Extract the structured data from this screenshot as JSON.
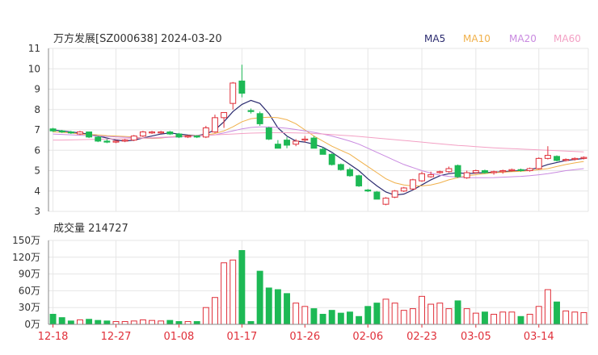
{
  "header": {
    "title": "万方发展[SZ000638] 2024-03-20",
    "ma_legend": [
      {
        "label": "MA5",
        "color": "#2b2b6f"
      },
      {
        "label": "MA10",
        "color": "#f0b04a"
      },
      {
        "label": "MA20",
        "color": "#c98ae0"
      },
      {
        "label": "MA60",
        "color": "#f3a0c4"
      }
    ]
  },
  "volume_panel": {
    "title": "成交量 214727",
    "y_ticks": [
      "150万",
      "120万",
      "90万",
      "60万",
      "30万",
      "0万"
    ]
  },
  "colors": {
    "up": "#e0303a",
    "down": "#1db955",
    "grid": "#e6e6e6",
    "axis": "#888888"
  },
  "chart_data": {
    "type": "candlestick",
    "ylim": [
      3,
      11
    ],
    "y_ticks": [
      "11",
      "10",
      "9",
      "8",
      "7",
      "6",
      "5",
      "4",
      "3"
    ],
    "x_tick_labels": [
      {
        "label": "12-18",
        "index": 0
      },
      {
        "label": "12-27",
        "index": 7
      },
      {
        "label": "01-08",
        "index": 14
      },
      {
        "label": "01-17",
        "index": 21
      },
      {
        "label": "01-26",
        "index": 28
      },
      {
        "label": "02-06",
        "index": 35
      },
      {
        "label": "02-23",
        "index": 41
      },
      {
        "label": "03-05",
        "index": 47
      },
      {
        "label": "03-14",
        "index": 54
      }
    ],
    "volume_unit": "万",
    "volume_ylim": [
      0,
      150
    ],
    "candles": [
      {
        "o": 7.05,
        "h": 7.1,
        "l": 6.9,
        "c": 6.95,
        "v": 18
      },
      {
        "o": 6.95,
        "h": 7.0,
        "l": 6.85,
        "c": 6.9,
        "v": 12
      },
      {
        "o": 6.9,
        "h": 6.95,
        "l": 6.8,
        "c": 6.85,
        "v": 6
      },
      {
        "o": 6.8,
        "h": 6.95,
        "l": 6.75,
        "c": 6.9,
        "v": 8
      },
      {
        "o": 6.9,
        "h": 6.92,
        "l": 6.6,
        "c": 6.65,
        "v": 9
      },
      {
        "o": 6.65,
        "h": 6.7,
        "l": 6.4,
        "c": 6.45,
        "v": 7
      },
      {
        "o": 6.45,
        "h": 6.55,
        "l": 6.35,
        "c": 6.4,
        "v": 6
      },
      {
        "o": 6.4,
        "h": 6.5,
        "l": 6.35,
        "c": 6.45,
        "v": 5
      },
      {
        "o": 6.45,
        "h": 6.55,
        "l": 6.4,
        "c": 6.5,
        "v": 5
      },
      {
        "o": 6.5,
        "h": 6.75,
        "l": 6.45,
        "c": 6.7,
        "v": 6
      },
      {
        "o": 6.7,
        "h": 6.95,
        "l": 6.65,
        "c": 6.9,
        "v": 8
      },
      {
        "o": 6.85,
        "h": 6.95,
        "l": 6.8,
        "c": 6.9,
        "v": 7
      },
      {
        "o": 6.85,
        "h": 6.95,
        "l": 6.8,
        "c": 6.9,
        "v": 6
      },
      {
        "o": 6.9,
        "h": 6.95,
        "l": 6.75,
        "c": 6.8,
        "v": 7
      },
      {
        "o": 6.8,
        "h": 6.85,
        "l": 6.6,
        "c": 6.65,
        "v": 5
      },
      {
        "o": 6.65,
        "h": 6.75,
        "l": 6.6,
        "c": 6.7,
        "v": 5
      },
      {
        "o": 6.7,
        "h": 6.75,
        "l": 6.6,
        "c": 6.65,
        "v": 5
      },
      {
        "o": 6.65,
        "h": 7.2,
        "l": 6.6,
        "c": 7.1,
        "v": 30
      },
      {
        "o": 6.9,
        "h": 7.75,
        "l": 6.85,
        "c": 7.6,
        "v": 48
      },
      {
        "o": 7.6,
        "h": 7.85,
        "l": 7.1,
        "c": 7.85,
        "v": 110
      },
      {
        "o": 8.3,
        "h": 9.35,
        "l": 8.0,
        "c": 9.3,
        "v": 115
      },
      {
        "o": 9.4,
        "h": 10.2,
        "l": 8.6,
        "c": 8.8,
        "v": 132
      },
      {
        "o": 7.95,
        "h": 8.05,
        "l": 7.8,
        "c": 7.9,
        "v": 5
      },
      {
        "o": 7.8,
        "h": 7.9,
        "l": 7.2,
        "c": 7.3,
        "v": 95
      },
      {
        "o": 7.1,
        "h": 7.15,
        "l": 6.5,
        "c": 6.55,
        "v": 65
      },
      {
        "o": 6.3,
        "h": 6.5,
        "l": 6.1,
        "c": 6.1,
        "v": 62
      },
      {
        "o": 6.5,
        "h": 6.65,
        "l": 6.1,
        "c": 6.25,
        "v": 55
      },
      {
        "o": 6.3,
        "h": 6.55,
        "l": 6.2,
        "c": 6.45,
        "v": 38
      },
      {
        "o": 6.5,
        "h": 6.7,
        "l": 6.4,
        "c": 6.55,
        "v": 32
      },
      {
        "o": 6.6,
        "h": 6.7,
        "l": 6.2,
        "c": 6.1,
        "v": 28
      },
      {
        "o": 6.05,
        "h": 6.15,
        "l": 5.8,
        "c": 5.8,
        "v": 18
      },
      {
        "o": 5.8,
        "h": 5.85,
        "l": 5.25,
        "c": 5.3,
        "v": 25
      },
      {
        "o": 5.3,
        "h": 5.35,
        "l": 5.0,
        "c": 5.05,
        "v": 20
      },
      {
        "o": 5.05,
        "h": 5.15,
        "l": 4.7,
        "c": 4.75,
        "v": 22
      },
      {
        "o": 4.75,
        "h": 4.8,
        "l": 4.2,
        "c": 4.25,
        "v": 14
      },
      {
        "o": 4.05,
        "h": 4.1,
        "l": 3.95,
        "c": 4.0,
        "v": 32
      },
      {
        "o": 3.95,
        "h": 4.0,
        "l": 3.6,
        "c": 3.6,
        "v": 38
      },
      {
        "o": 3.35,
        "h": 3.7,
        "l": 3.3,
        "c": 3.65,
        "v": 45
      },
      {
        "o": 3.7,
        "h": 4.05,
        "l": 3.65,
        "c": 4.0,
        "v": 38
      },
      {
        "o": 4.0,
        "h": 4.2,
        "l": 3.95,
        "c": 4.15,
        "v": 25
      },
      {
        "o": 4.1,
        "h": 4.6,
        "l": 4.05,
        "c": 4.55,
        "v": 28
      },
      {
        "o": 4.5,
        "h": 4.95,
        "l": 4.45,
        "c": 4.85,
        "v": 50
      },
      {
        "o": 4.7,
        "h": 4.95,
        "l": 4.65,
        "c": 4.8,
        "v": 36
      },
      {
        "o": 4.9,
        "h": 5.0,
        "l": 4.85,
        "c": 4.95,
        "v": 38
      },
      {
        "o": 4.95,
        "h": 5.2,
        "l": 4.9,
        "c": 5.1,
        "v": 28
      },
      {
        "o": 5.25,
        "h": 5.3,
        "l": 4.65,
        "c": 4.7,
        "v": 42
      },
      {
        "o": 4.65,
        "h": 5.0,
        "l": 4.6,
        "c": 4.9,
        "v": 28
      },
      {
        "o": 4.9,
        "h": 5.05,
        "l": 4.85,
        "c": 5.0,
        "v": 20
      },
      {
        "o": 5.0,
        "h": 5.05,
        "l": 4.85,
        "c": 4.9,
        "v": 22
      },
      {
        "o": 4.9,
        "h": 5.0,
        "l": 4.8,
        "c": 4.95,
        "v": 18
      },
      {
        "o": 4.95,
        "h": 5.05,
        "l": 4.85,
        "c": 5.0,
        "v": 22
      },
      {
        "o": 5.0,
        "h": 5.1,
        "l": 4.95,
        "c": 5.05,
        "v": 22
      },
      {
        "o": 5.05,
        "h": 5.1,
        "l": 4.95,
        "c": 5.0,
        "v": 14
      },
      {
        "o": 5.0,
        "h": 5.15,
        "l": 4.95,
        "c": 5.1,
        "v": 18
      },
      {
        "o": 5.1,
        "h": 5.65,
        "l": 5.05,
        "c": 5.6,
        "v": 32
      },
      {
        "o": 5.6,
        "h": 6.2,
        "l": 5.55,
        "c": 5.75,
        "v": 62
      },
      {
        "o": 5.7,
        "h": 5.75,
        "l": 5.45,
        "c": 5.5,
        "v": 40
      },
      {
        "o": 5.5,
        "h": 5.6,
        "l": 5.45,
        "c": 5.55,
        "v": 24
      },
      {
        "o": 5.55,
        "h": 5.65,
        "l": 5.5,
        "c": 5.6,
        "v": 22
      },
      {
        "o": 5.6,
        "h": 5.7,
        "l": 5.55,
        "c": 5.65,
        "v": 21
      }
    ],
    "ma": {
      "MA5": [
        7.0,
        6.95,
        6.9,
        6.85,
        6.8,
        6.7,
        6.6,
        6.5,
        6.45,
        6.5,
        6.6,
        6.7,
        6.8,
        6.85,
        6.8,
        6.75,
        6.72,
        6.8,
        7.0,
        7.4,
        7.9,
        8.25,
        8.45,
        8.3,
        7.8,
        7.1,
        6.7,
        6.45,
        6.4,
        6.3,
        6.15,
        5.9,
        5.6,
        5.3,
        5.0,
        4.6,
        4.25,
        3.95,
        3.8,
        3.85,
        4.05,
        4.3,
        4.55,
        4.75,
        4.85,
        4.9,
        4.85,
        4.88,
        4.9,
        4.92,
        4.95,
        4.98,
        5.0,
        5.05,
        5.15,
        5.3,
        5.4,
        5.5,
        5.55,
        5.6
      ],
      "MA10": [
        6.9,
        6.88,
        6.85,
        6.8,
        6.78,
        6.75,
        6.72,
        6.7,
        6.68,
        6.65,
        6.6,
        6.58,
        6.6,
        6.65,
        6.7,
        6.72,
        6.72,
        6.75,
        6.82,
        6.95,
        7.15,
        7.4,
        7.55,
        7.6,
        7.62,
        7.6,
        7.5,
        7.3,
        7.0,
        6.7,
        6.45,
        6.2,
        6.0,
        5.8,
        5.5,
        5.2,
        4.9,
        4.6,
        4.4,
        4.3,
        4.25,
        4.25,
        4.3,
        4.4,
        4.55,
        4.65,
        4.75,
        4.8,
        4.85,
        4.9,
        4.92,
        4.95,
        4.97,
        5.0,
        5.05,
        5.1,
        5.2,
        5.3,
        5.38,
        5.45
      ],
      "MA20": [
        6.8,
        6.78,
        6.76,
        6.74,
        6.72,
        6.7,
        6.68,
        6.66,
        6.64,
        6.62,
        6.6,
        6.6,
        6.62,
        6.64,
        6.66,
        6.68,
        6.7,
        6.72,
        6.76,
        6.85,
        6.95,
        7.05,
        7.12,
        7.15,
        7.15,
        7.12,
        7.08,
        7.02,
        6.95,
        6.88,
        6.8,
        6.7,
        6.58,
        6.45,
        6.3,
        6.1,
        5.9,
        5.7,
        5.5,
        5.3,
        5.15,
        5.0,
        4.88,
        4.78,
        4.72,
        4.68,
        4.66,
        4.65,
        4.65,
        4.66,
        4.68,
        4.7,
        4.72,
        4.75,
        4.8,
        4.85,
        4.92,
        5.0,
        5.05,
        5.1
      ],
      "MA60": [
        6.5,
        6.5,
        6.51,
        6.52,
        6.53,
        6.54,
        6.55,
        6.56,
        6.57,
        6.58,
        6.6,
        6.62,
        6.64,
        6.66,
        6.68,
        6.7,
        6.72,
        6.74,
        6.76,
        6.78,
        6.8,
        6.82,
        6.84,
        6.85,
        6.86,
        6.86,
        6.86,
        6.85,
        6.84,
        6.82,
        6.8,
        6.77,
        6.74,
        6.71,
        6.68,
        6.64,
        6.6,
        6.56,
        6.52,
        6.48,
        6.44,
        6.4,
        6.36,
        6.32,
        6.28,
        6.24,
        6.21,
        6.18,
        6.15,
        6.12,
        6.1,
        6.08,
        6.06,
        6.04,
        6.02,
        6.0,
        5.98,
        5.96,
        5.94,
        5.92
      ]
    }
  }
}
